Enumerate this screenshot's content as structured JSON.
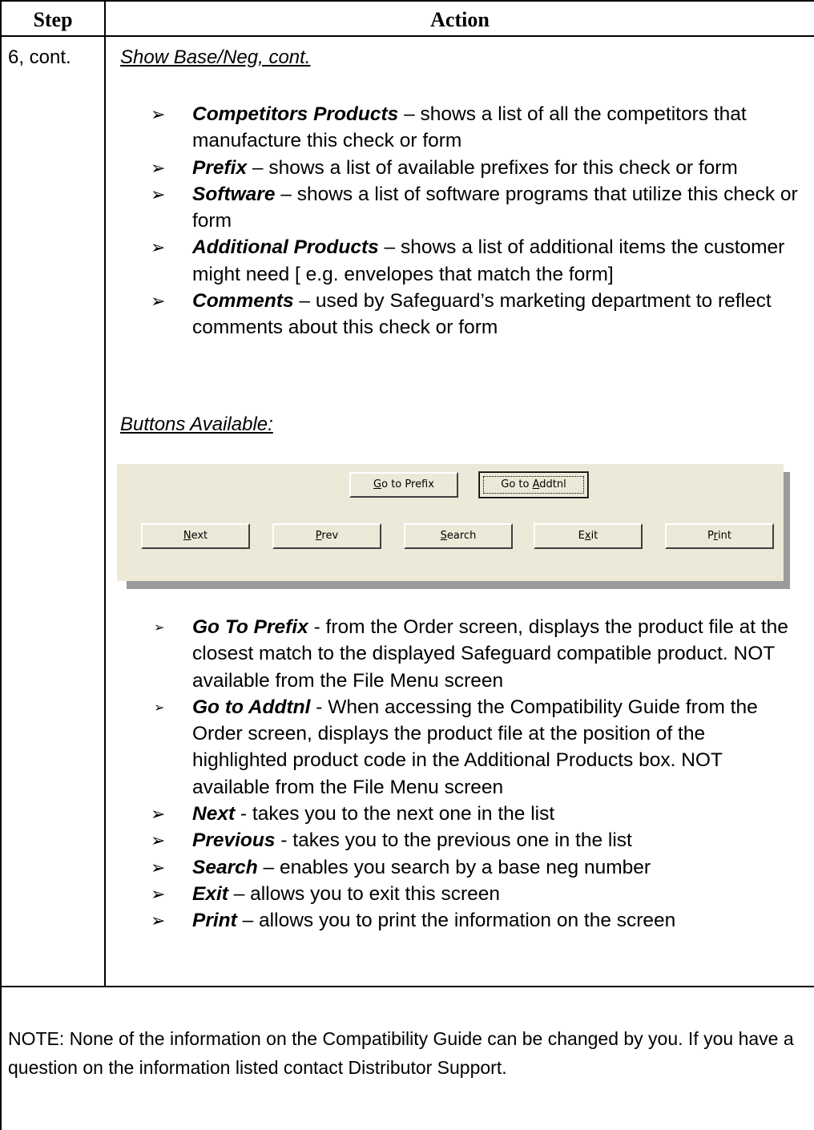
{
  "header": {
    "step": "Step",
    "action": "Action"
  },
  "row": {
    "step": "6, cont.",
    "section_title": "Show Base/Neg, cont.",
    "fields": [
      {
        "term": "Competitors Products",
        "text": " – shows a list of all the competitors that manufacture this check or form"
      },
      {
        "term": "Prefix",
        "text": " – shows a list of available prefixes for this check or form"
      },
      {
        "term": "Software",
        "text": " – shows a list of software programs that utilize this check or form"
      },
      {
        "term": "Additional Products",
        "text": " – shows a list of additional items the customer might need [ e.g. envelopes that match the form]"
      },
      {
        "term": "Comments",
        "text": " – used by Safeguard’s marketing department  to reflect comments about this check or form"
      }
    ],
    "buttons_title": "Buttons Available:",
    "dialog": {
      "go_to_prefix": {
        "pre": "",
        "u": "G",
        "post": "o to Prefix"
      },
      "go_to_addtnl": {
        "pre": "Go to ",
        "u": "A",
        "post": "ddtnl"
      },
      "next": {
        "pre": "",
        "u": "N",
        "post": "ext"
      },
      "prev": {
        "pre": "",
        "u": "P",
        "post": "rev"
      },
      "search": {
        "pre": "",
        "u": "S",
        "post": "earch"
      },
      "exit": {
        "pre": "E",
        "u": "x",
        "post": "it"
      },
      "print": {
        "pre": "P",
        "u": "r",
        "post": "int"
      }
    },
    "button_desc": [
      {
        "term": "Go To Prefix",
        "text": " - from the Order screen, displays the product file at the closest match to the displayed Safeguard compatible product. NOT available from the File Menu screen"
      },
      {
        "term": "Go to Addtnl",
        "text": " - When accessing the Compatibility Guide from the Order screen, displays the product file at the position of the highlighted product code in the Additional Products box. NOT available from the File Menu screen"
      },
      {
        "term": "Next",
        "text": "  - takes you to the next one in the list"
      },
      {
        "term": "Previous",
        "text": " - takes you to the previous one in the list"
      },
      {
        "term": "Search",
        "text": " – enables  you search by a base neg number"
      },
      {
        "term": "Exit",
        "text": " – allows you to exit this screen"
      },
      {
        "term": "Print",
        "text": " – allows you to print the information on the screen"
      }
    ]
  },
  "note": "NOTE: None of the information on the Compatibility Guide can be changed by you. If you have a question on the information listed contact Distributor Support."
}
